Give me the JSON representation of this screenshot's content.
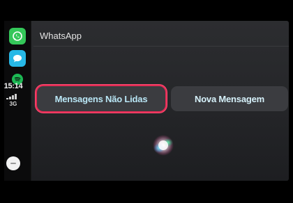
{
  "header": {
    "app_title": "WhatsApp"
  },
  "dock": {
    "apps": [
      {
        "name": "whatsapp-icon"
      },
      {
        "name": "messages-icon"
      },
      {
        "name": "spotify-icon"
      }
    ],
    "time": "15:14",
    "network": "3G"
  },
  "actions": {
    "unread_label": "Mensagens Não Lidas",
    "new_message_label": "Nova Mensagem"
  },
  "colors": {
    "focus_ring": "#e32c55",
    "button_text": "#b9e6f5",
    "whatsapp_green": "#34c759"
  }
}
